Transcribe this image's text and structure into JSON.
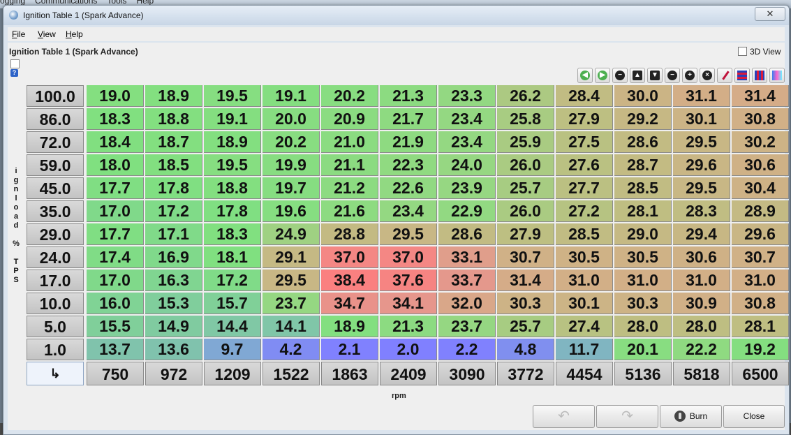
{
  "background_menu": [
    "ogging",
    "Communications",
    "Tools",
    "Help"
  ],
  "window": {
    "title": "Ignition Table 1 (Spark Advance)"
  },
  "menu": [
    "File",
    "View",
    "Help"
  ],
  "panel": {
    "title": "Ignition Table 1 (Spark Advance)",
    "view3d_label": "3D View",
    "view3d_checked": false
  },
  "toolbar_icons": [
    "arrow-left-icon",
    "arrow-right-icon",
    "minus-circle-icon",
    "arrow-up-icon",
    "arrow-down-icon",
    "minus-icon",
    "plus-icon",
    "close-circle-icon",
    "pencil-icon",
    "horizontal-lines-icon",
    "vertical-lines-icon",
    "color-gradient-icon"
  ],
  "table": {
    "y_axis_label": "ignload % TPS",
    "y_axis_letters": [
      "i",
      "g",
      "n",
      "l",
      "o",
      "a",
      "d",
      "",
      "%",
      "",
      "T",
      "P",
      "S"
    ],
    "x_axis_label": "rpm",
    "corner_symbol": "↳",
    "load_bins": [
      "100.0",
      "86.0",
      "72.0",
      "59.0",
      "45.0",
      "35.0",
      "29.0",
      "24.0",
      "17.0",
      "10.0",
      "5.0",
      "1.0"
    ],
    "rpm_bins": [
      "750",
      "972",
      "1209",
      "1522",
      "1863",
      "2409",
      "3090",
      "3772",
      "4454",
      "5136",
      "5818",
      "6500"
    ],
    "values": [
      [
        "19.0",
        "18.9",
        "19.5",
        "19.1",
        "20.2",
        "21.3",
        "23.3",
        "26.2",
        "28.4",
        "30.0",
        "31.1",
        "31.4"
      ],
      [
        "18.3",
        "18.8",
        "19.1",
        "20.0",
        "20.9",
        "21.7",
        "23.4",
        "25.8",
        "27.9",
        "29.2",
        "30.1",
        "30.8"
      ],
      [
        "18.4",
        "18.7",
        "18.9",
        "20.2",
        "21.0",
        "21.9",
        "23.4",
        "25.9",
        "27.5",
        "28.6",
        "29.5",
        "30.2"
      ],
      [
        "18.0",
        "18.5",
        "19.5",
        "19.9",
        "21.1",
        "22.3",
        "24.0",
        "26.0",
        "27.6",
        "28.7",
        "29.6",
        "30.6"
      ],
      [
        "17.7",
        "17.8",
        "18.8",
        "19.7",
        "21.2",
        "22.6",
        "23.9",
        "25.7",
        "27.7",
        "28.5",
        "29.5",
        "30.4"
      ],
      [
        "17.0",
        "17.2",
        "17.8",
        "19.6",
        "21.6",
        "23.4",
        "22.9",
        "26.0",
        "27.2",
        "28.1",
        "28.3",
        "28.9"
      ],
      [
        "17.7",
        "17.1",
        "18.3",
        "24.9",
        "28.8",
        "29.5",
        "28.6",
        "27.9",
        "28.5",
        "29.0",
        "29.4",
        "29.6"
      ],
      [
        "17.4",
        "16.9",
        "18.1",
        "29.1",
        "37.0",
        "37.0",
        "33.1",
        "30.7",
        "30.5",
        "30.5",
        "30.6",
        "30.7"
      ],
      [
        "17.0",
        "16.3",
        "17.2",
        "29.5",
        "38.4",
        "37.6",
        "33.7",
        "31.4",
        "31.0",
        "31.0",
        "31.0",
        "31.0"
      ],
      [
        "16.0",
        "15.3",
        "15.7",
        "23.7",
        "34.7",
        "34.1",
        "32.0",
        "30.3",
        "30.1",
        "30.3",
        "30.9",
        "30.8"
      ],
      [
        "15.5",
        "14.9",
        "14.4",
        "14.1",
        "18.9",
        "21.3",
        "23.7",
        "25.7",
        "27.4",
        "28.0",
        "28.0",
        "28.1"
      ],
      [
        "13.7",
        "13.6",
        "9.7",
        "4.2",
        "2.1",
        "2.0",
        "2.2",
        "4.8",
        "11.7",
        "20.1",
        "22.2",
        "19.2"
      ]
    ]
  },
  "buttons": {
    "undo": "",
    "redo": "",
    "burn": "Burn",
    "close": "Close"
  }
}
